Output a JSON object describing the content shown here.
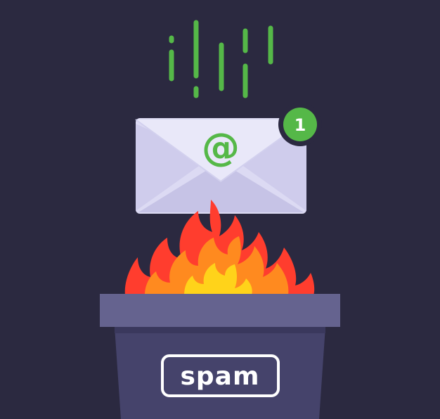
{
  "envelope": {
    "symbol": "@",
    "icon": "envelope-icon"
  },
  "notification": {
    "count": "1",
    "icon": "badge-icon"
  },
  "bin": {
    "label": "spam",
    "icon": "trash-bin-icon"
  },
  "fire": {
    "icon": "fire-icon"
  },
  "colors": {
    "background": "#2b2940",
    "accent_green": "#55b848",
    "envelope": "#dcdaf3",
    "bin_rim": "#65638f",
    "bin_body": "#45436b",
    "flame_red": "#ff3d2e",
    "flame_orange": "#ff8a1f",
    "flame_yellow": "#ffd31a"
  }
}
